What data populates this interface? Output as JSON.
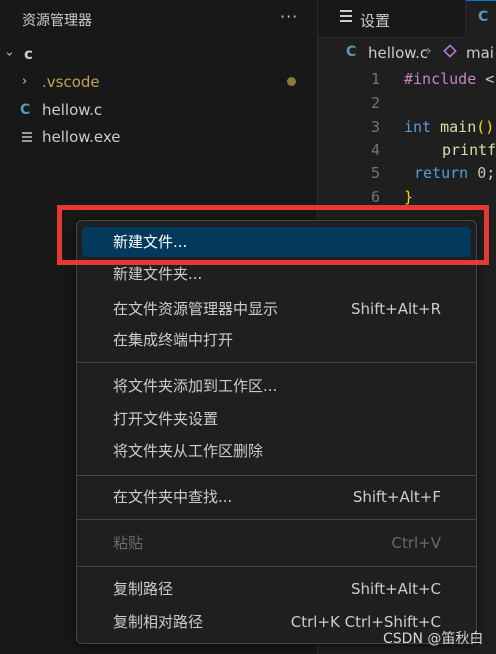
{
  "explorer": {
    "title": "资源管理器",
    "more": "···",
    "folder": {
      "name": "c",
      "chevron": "›"
    },
    "items": [
      {
        "name": ".vscode",
        "chevron": "›",
        "icon": "chevron-right-icon"
      },
      {
        "name": "hellow.c",
        "icon_text": "C"
      },
      {
        "name": "hellow.exe",
        "icon": "file-lines-icon"
      }
    ]
  },
  "tabs": {
    "settings_label": "设置",
    "c_tab_icon": "C"
  },
  "breadcrumb": {
    "icon_text": "C",
    "file": "hellow.c",
    "separator": "›",
    "symbol": "mai"
  },
  "editor": {
    "line_numbers": [
      "1",
      "2",
      "3",
      "4",
      "5",
      "6"
    ],
    "lines": {
      "l1_pre": "#include",
      "l1_rest": " <",
      "l3_kw": "int",
      "l3_fn": " main",
      "l3_br": "()",
      "l4_fn": "printf",
      "l5_kw": "return",
      "l5_num": " 0",
      "l5_rest": ";",
      "l6_br": "}"
    }
  },
  "context_menu": {
    "items": [
      {
        "label": "新建文件...",
        "shortcut": "",
        "state": "active"
      },
      {
        "label": "新建文件夹...",
        "shortcut": "",
        "state": "normal"
      },
      {
        "label": "在文件资源管理器中显示",
        "shortcut": "Shift+Alt+R",
        "state": "normal"
      },
      {
        "label": "在集成终端中打开",
        "shortcut": "",
        "state": "normal"
      },
      {
        "label": "将文件夹添加到工作区...",
        "shortcut": "",
        "state": "normal"
      },
      {
        "label": "打开文件夹设置",
        "shortcut": "",
        "state": "normal"
      },
      {
        "label": "将文件夹从工作区删除",
        "shortcut": "",
        "state": "normal"
      },
      {
        "label": "在文件夹中查找...",
        "shortcut": "Shift+Alt+F",
        "state": "normal"
      },
      {
        "label": "粘贴",
        "shortcut": "Ctrl+V",
        "state": "disabled"
      },
      {
        "label": "复制路径",
        "shortcut": "Shift+Alt+C",
        "state": "normal"
      },
      {
        "label": "复制相对路径",
        "shortcut": "Ctrl+K Ctrl+Shift+C",
        "state": "normal"
      }
    ]
  },
  "watermark": "CSDN @笛秋白",
  "colors": {
    "highlight_box": "#e53935",
    "active_item": "#04395e",
    "folder_vscode": "#c5a150",
    "c_icon": "#519aba"
  }
}
